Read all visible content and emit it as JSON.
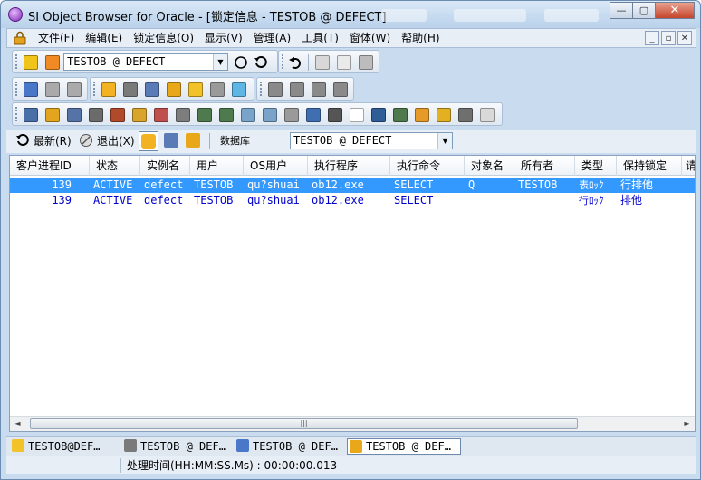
{
  "window": {
    "title": "SI Object Browser for Oracle - [锁定信息 - TESTOB @ DEFECT]",
    "minimize_glyph": "—",
    "maximize_glyph": "▢",
    "close_glyph": "✕"
  },
  "menubar": {
    "items": [
      "文件(F)",
      "编辑(E)",
      "锁定信息(O)",
      "显示(V)",
      "管理(A)",
      "工具(T)",
      "窗体(W)",
      "帮助(H)"
    ],
    "mdi_minimize": "_",
    "mdi_restore": "▫",
    "mdi_close": "✕"
  },
  "toolbar1": {
    "connection_combo": "TESTOB @ DEFECT",
    "combo_arrow": "▼"
  },
  "toolbar4": {
    "refresh_label": "最新(R)",
    "exit_label": "退出(X)",
    "database_label": "数据库",
    "database_combo": "TESTOB @ DEFECT",
    "combo_arrow": "▼"
  },
  "grid": {
    "columns": [
      "客户进程ID",
      "状态",
      "实例名",
      "用户",
      "OS用户",
      "执行程序",
      "执行命令",
      "对象名",
      "所有者",
      "类型",
      "保持锁定",
      "请"
    ],
    "rows": [
      [
        "139",
        "ACTIVE",
        "defect",
        "TESTOB",
        "qu?shuai",
        "ob12.exe",
        "SELECT",
        "Q",
        "TESTOB",
        "表ﾛｯｸ",
        "行排他"
      ],
      [
        "139",
        "ACTIVE",
        "defect",
        "TESTOB",
        "qu?shuai",
        "ob12.exe",
        "SELECT",
        "",
        "",
        "行ﾛｯｸ",
        "排他"
      ]
    ],
    "selected_row": 0,
    "scroll_left": "◄",
    "scroll_right": "►",
    "scroll_thumb_grip": "|||"
  },
  "taskbar": {
    "tabs": [
      "TESTOB@DEF…",
      "TESTOB @ DEF…",
      "TESTOB @ DEF…",
      "TESTOB @ DEF…"
    ],
    "active_tab": 3
  },
  "statusbar": {
    "text": "处理时间(HH:MM:SS.Ms) : 00:00:00.013"
  },
  "icons": [
    "app-logo-icon",
    "lock-icon",
    "add-icon",
    "refresh-icon",
    "undo-icon",
    "cut-icon",
    "copy-icon",
    "paste-icon",
    "sql-icon",
    "user-icon",
    "database-icon",
    "table-icon",
    "view-icon",
    "index-icon"
  ],
  "colors": {
    "selection": "#3399ff",
    "row_text": "#0000cc",
    "close_button": "#c4452c"
  }
}
